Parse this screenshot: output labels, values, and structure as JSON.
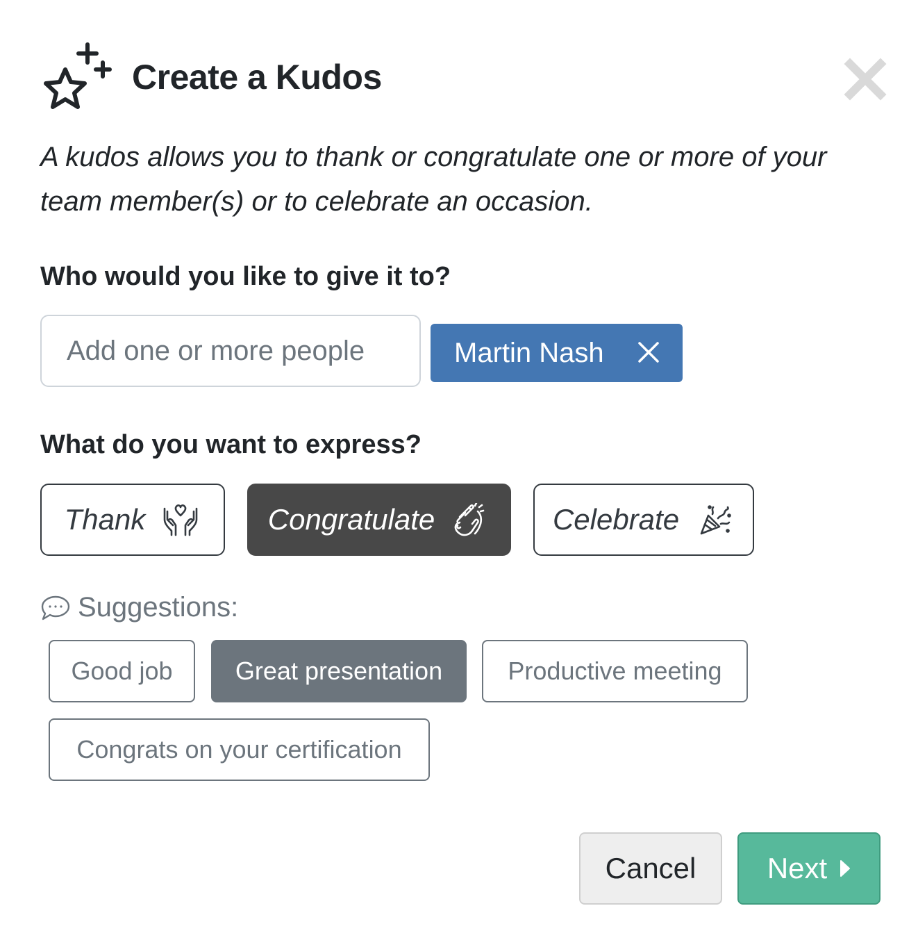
{
  "dialog": {
    "title": "Create a Kudos",
    "header_icon": "star-sparkle-icon",
    "close_icon": "close-icon",
    "description": "A kudos allows you to thank or congratulate one or more of your team member(s) or to celebrate an occasion."
  },
  "recipients": {
    "label": "Who would you like to give it to?",
    "input_placeholder": "Add one or more people",
    "input_value": "",
    "selected": [
      {
        "name": "Martin Nash",
        "remove_icon": "close-icon"
      }
    ],
    "chip_color": "#4477b3"
  },
  "express": {
    "label": "What do you want to express?",
    "options": [
      {
        "label": "Thank",
        "icon": "hands-heart-icon",
        "selected": false
      },
      {
        "label": "Congratulate",
        "icon": "clapping-hands-icon",
        "selected": true
      },
      {
        "label": "Celebrate",
        "icon": "party-popper-icon",
        "selected": false
      }
    ],
    "selected_color": "#484848"
  },
  "suggestions": {
    "label": "Suggestions:",
    "icon": "speech-bubble-icon",
    "items": [
      {
        "label": "Good job",
        "selected": false
      },
      {
        "label": "Great presentation",
        "selected": true
      },
      {
        "label": "Productive meeting",
        "selected": false
      },
      {
        "label": "Congrats on your certification",
        "selected": false
      }
    ],
    "selected_color": "#6c757d"
  },
  "footer": {
    "cancel_label": "Cancel",
    "next_label": "Next",
    "next_icon": "caret-right-icon",
    "next_color": "#57b99b"
  }
}
